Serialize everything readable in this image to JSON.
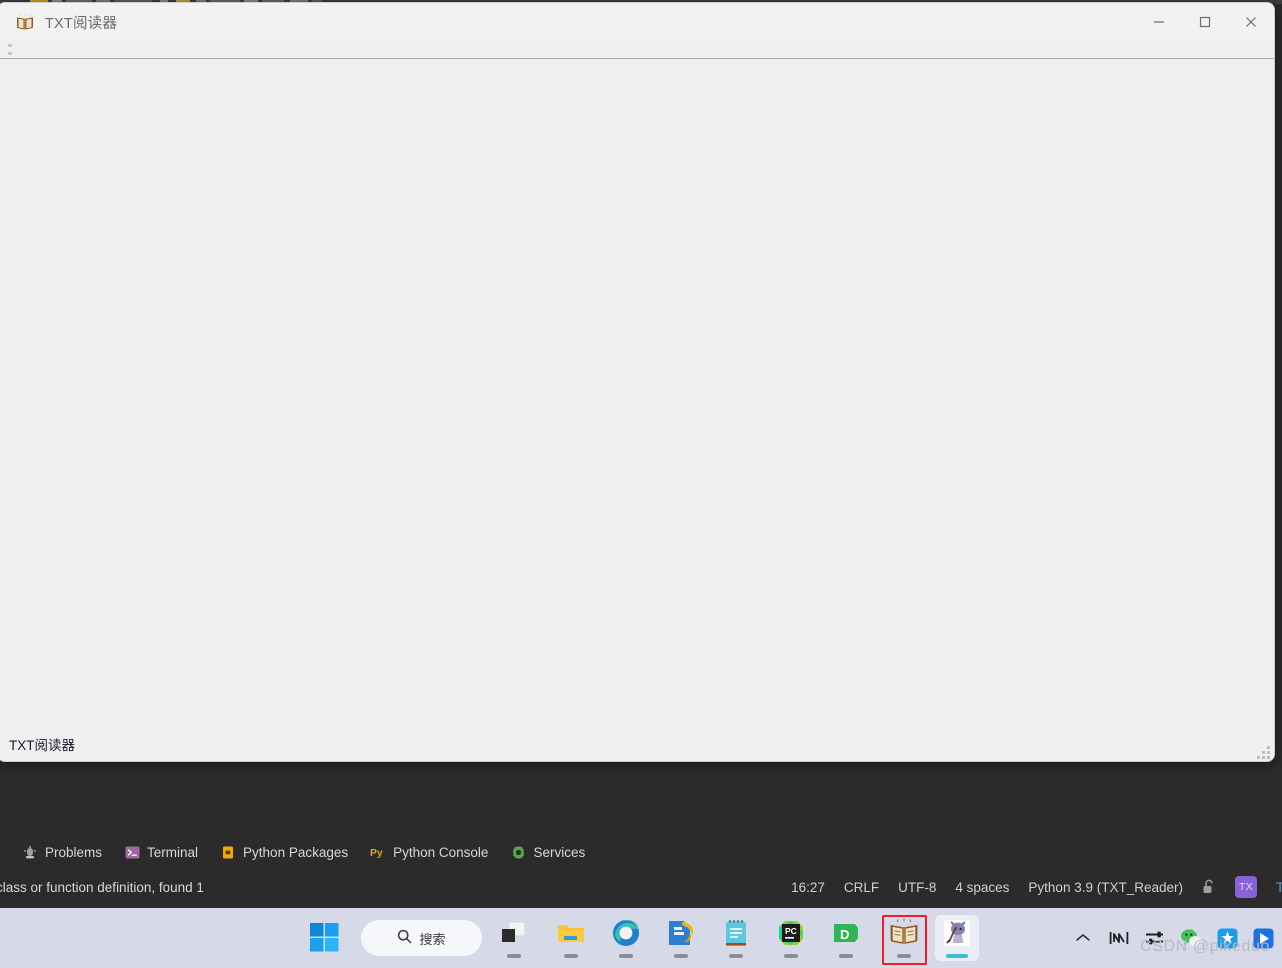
{
  "app_window": {
    "title": "TXT阅读器",
    "title_icon": "open-book-icon",
    "bottom_label": "TXT阅读器",
    "controls": {
      "minimize": "–",
      "maximize": "□",
      "close": "✕"
    }
  },
  "ide": {
    "tool_windows": [
      {
        "label": "Problems",
        "icon": "problems-icon"
      },
      {
        "label": "Terminal",
        "icon": "terminal-icon"
      },
      {
        "label": "Python Packages",
        "icon": "python-packages-icon"
      },
      {
        "label": "Python Console",
        "icon": "python-console-icon"
      },
      {
        "label": "Services",
        "icon": "services-gear-icon"
      }
    ],
    "status_bar": {
      "message": "class or function definition, found 1",
      "time": "16:27",
      "line_separator": "CRLF",
      "encoding": "UTF-8",
      "indent": "4 spaces",
      "interpreter": "Python 3.9 (TXT_Reader)",
      "lock_icon": "unlocked-padlock-icon",
      "badge": "TX",
      "trailing": "TX"
    }
  },
  "taskbar": {
    "start_icon": "windows-start-icon",
    "search_placeholder": "搜索",
    "search_icon": "search-icon",
    "apps": [
      {
        "name": "task-view",
        "running": true,
        "active": false
      },
      {
        "name": "file-explorer",
        "running": true,
        "active": false
      },
      {
        "name": "microsoft-edge",
        "running": true,
        "active": false
      },
      {
        "name": "wps-office",
        "running": true,
        "active": false
      },
      {
        "name": "notepad-app",
        "running": true,
        "active": false
      },
      {
        "name": "pycharm",
        "running": true,
        "active": false
      },
      {
        "name": "dingtalk",
        "running": true,
        "active": false
      },
      {
        "name": "txt-reader-book",
        "running": true,
        "active": false
      },
      {
        "name": "game-avatar",
        "running": true,
        "active": true
      }
    ],
    "tray": [
      "chevron-up-icon",
      "display-monitor-icon",
      "audio-mixer-icon",
      "wechat-icon",
      "blue-star-icon",
      "blue-play-icon"
    ]
  },
  "watermark": "CSDN @pikeduo",
  "colors": {
    "ide_background": "#2b2b2b",
    "window_background": "#f0f0f0",
    "taskbar_background": "#d6dae8",
    "highlight_red": "#ee1c24",
    "badge_purple": "#8a62d8"
  }
}
